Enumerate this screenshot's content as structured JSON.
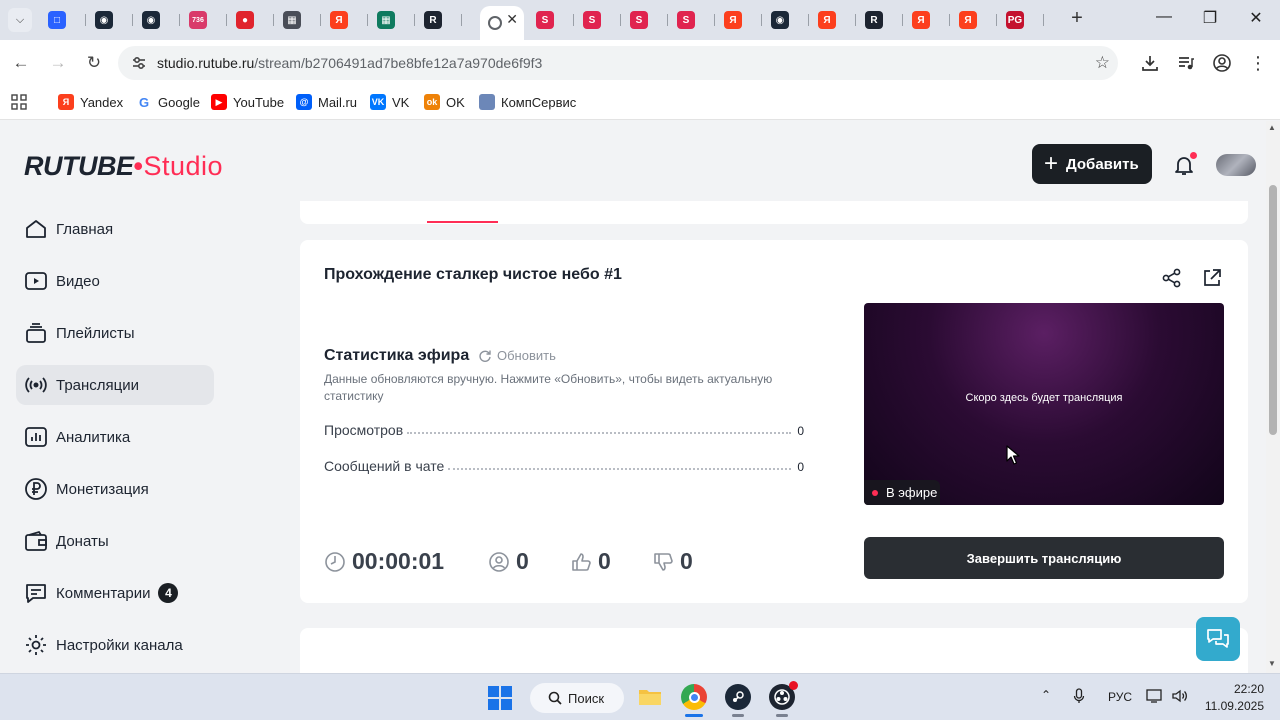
{
  "browser": {
    "tabs": [
      {
        "icon": "tabs-dropdown-icon",
        "color": "#e9ecf2"
      },
      {
        "icon": "chat-tab-icon",
        "color": "#2a62ff"
      },
      {
        "icon": "steam-tab-icon",
        "color": "#1b2838"
      },
      {
        "icon": "steam-tab-icon",
        "color": "#1b2838"
      },
      {
        "icon": "mail-badge-tab-icon",
        "color": "#d93a6a",
        "badge": "736"
      },
      {
        "icon": "record-tab-icon",
        "color": "#e0242d"
      },
      {
        "icon": "app-tab-icon",
        "color": "#4a4e58"
      },
      {
        "icon": "yandex-tab-icon",
        "color": "#fc3f1d"
      },
      {
        "icon": "windows-tab-icon",
        "color": "#0f7b5f"
      },
      {
        "icon": "rutube-tab-icon",
        "color": "#1d2430"
      },
      {
        "icon": "rutube-studio-tab-icon",
        "color": "#ffffff",
        "active": true
      },
      {
        "icon": "s-tab-icon",
        "color": "#e0244f"
      },
      {
        "icon": "s-tab-icon",
        "color": "#e0244f"
      },
      {
        "icon": "s-tab-icon",
        "color": "#e0244f"
      },
      {
        "icon": "s-tab-icon",
        "color": "#e0244f"
      },
      {
        "icon": "yandex-tab-icon",
        "color": "#fc3f1d"
      },
      {
        "icon": "steam-tab-icon",
        "color": "#1b2838"
      },
      {
        "icon": "yandex-tab-icon",
        "color": "#fc3f1d"
      },
      {
        "icon": "rutube-tab-icon",
        "color": "#1d2430"
      },
      {
        "icon": "yandex-tab-icon",
        "color": "#fc3f1d"
      },
      {
        "icon": "yandex-tab-icon",
        "color": "#fc3f1d"
      },
      {
        "icon": "pg-tab-icon",
        "color": "#c4122f"
      }
    ],
    "new_tab_label": "+",
    "url_host": "studio.rutube.ru",
    "url_path": "/stream/b2706491ad7be8bfe12a7a970de6f9f3",
    "bookmarks": [
      {
        "label": "Yandex",
        "icon": "yandex-icon",
        "color": "#fc3f1d",
        "glyph": "Я"
      },
      {
        "label": "Google",
        "icon": "google-icon",
        "color": "#4285f4",
        "glyph": "G"
      },
      {
        "label": "YouTube",
        "icon": "youtube-icon",
        "color": "#ff0000",
        "glyph": "▶"
      },
      {
        "label": "Mail.ru",
        "icon": "mailru-icon",
        "color": "#005ff9",
        "glyph": "@"
      },
      {
        "label": "VK",
        "icon": "vk-icon",
        "color": "#0077ff",
        "glyph": "VK"
      },
      {
        "label": "OK",
        "icon": "ok-icon",
        "color": "#ee8208",
        "glyph": "ok"
      },
      {
        "label": "КомпСервис",
        "icon": "monitor-icon",
        "color": "#6c87b8",
        "glyph": ""
      }
    ]
  },
  "header": {
    "logo_main": "RUTUBE",
    "logo_dot": "•",
    "logo_studio": "Studio",
    "add_button": "Добавить",
    "accent": "#ff2d55"
  },
  "sidebar": {
    "items": [
      {
        "label": "Главная",
        "icon": "home-icon"
      },
      {
        "label": "Видео",
        "icon": "video-icon"
      },
      {
        "label": "Плейлисты",
        "icon": "playlist-icon"
      },
      {
        "label": "Трансляции",
        "icon": "broadcast-icon",
        "active": true
      },
      {
        "label": "Аналитика",
        "icon": "analytics-icon"
      },
      {
        "label": "Монетизация",
        "icon": "ruble-icon"
      },
      {
        "label": "Донаты",
        "icon": "wallet-icon"
      },
      {
        "label": "Комментарии",
        "icon": "comment-icon",
        "count": "4"
      },
      {
        "label": "Настройки канала",
        "icon": "gear-icon"
      }
    ]
  },
  "stream": {
    "title": "Прохождение сталкер чистое небо #1",
    "stats_title": "Статистика эфира",
    "refresh_label": "Обновить",
    "stats_desc": "Данные обновляются вручную. Нажмите «Обновить», чтобы видеть актуальную статистику",
    "stats": [
      {
        "label": "Просмотров",
        "value": "0"
      },
      {
        "label": "Сообщений в чате",
        "value": "0"
      }
    ],
    "duration": "00:00:01",
    "viewers": "0",
    "likes": "0",
    "dislikes": "0",
    "preview_text": "Скоро здесь будет трансляция",
    "live_label": "В эфире",
    "end_button": "Завершить трансляцию"
  },
  "taskbar": {
    "search_label": "Поиск",
    "lang": "РУС",
    "time": "22:20",
    "date": "11.09.2025"
  }
}
